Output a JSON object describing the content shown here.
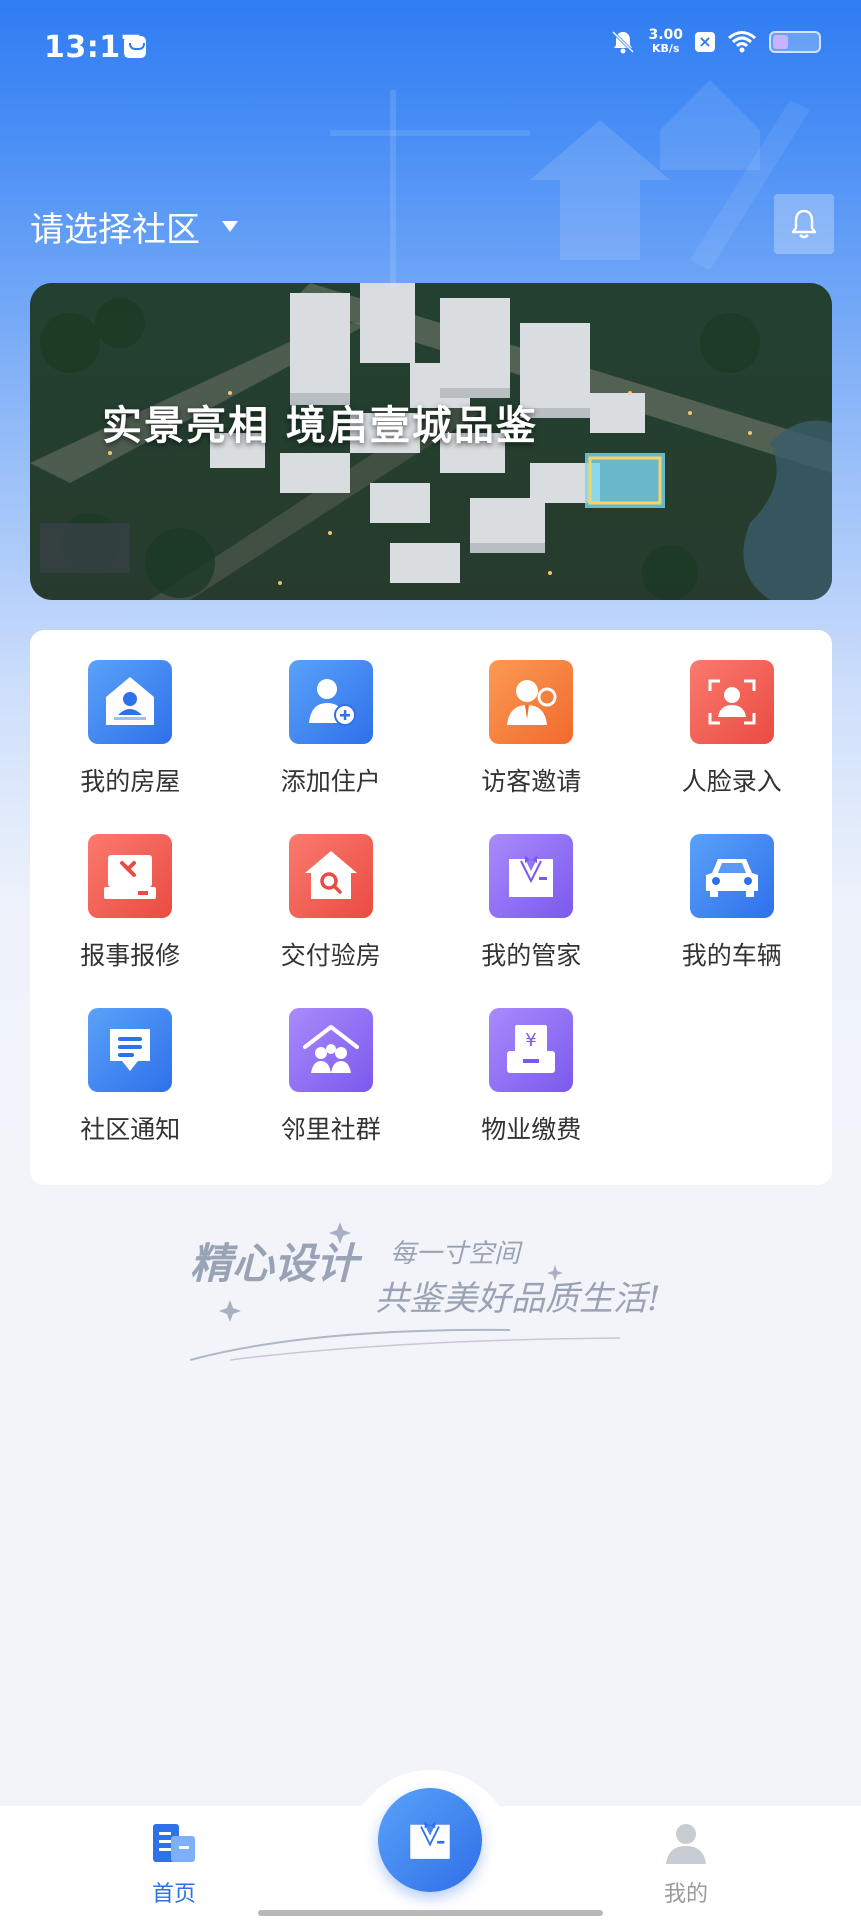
{
  "status_bar": {
    "time": "13:17",
    "net_speed_value": "3.00",
    "net_speed_unit": "KB/s",
    "battery_level": 0.35,
    "icons": [
      "message-icon",
      "bell-off-icon",
      "close-box-icon",
      "wifi-icon",
      "battery-icon"
    ]
  },
  "header": {
    "community_selector": "请选择社区",
    "bell_icon": "bell-icon"
  },
  "banner": {
    "text": "实景亮相 境启壹城品鉴"
  },
  "services": [
    {
      "label": "我的房屋",
      "icon": "house-icon",
      "color": "#2f70eb"
    },
    {
      "label": "添加住户",
      "icon": "add-resident-icon",
      "color": "#2f70eb"
    },
    {
      "label": "访客邀请",
      "icon": "visitor-invite-icon",
      "color": "#f26a2c"
    },
    {
      "label": "人脸录入",
      "icon": "face-scan-icon",
      "color": "#ea4b42"
    },
    {
      "label": "报事报修",
      "icon": "repair-icon",
      "color": "#ea4b42"
    },
    {
      "label": "交付验房",
      "icon": "house-inspect-icon",
      "color": "#ea4b42"
    },
    {
      "label": "我的管家",
      "icon": "butler-icon",
      "color": "#7b59ee"
    },
    {
      "label": "我的车辆",
      "icon": "car-icon",
      "color": "#2f70eb"
    },
    {
      "label": "社区通知",
      "icon": "notice-icon",
      "color": "#2f70eb"
    },
    {
      "label": "邻里社群",
      "icon": "neighbors-icon",
      "color": "#7b59ee"
    },
    {
      "label": "物业缴费",
      "icon": "payment-icon",
      "color": "#7b59ee"
    }
  ],
  "slogan": {
    "line1_big": "精心设计",
    "line1_small": "每一寸空间",
    "line2": "共鉴美好品质生活!"
  },
  "tabbar": {
    "home_label": "首页",
    "mine_label": "我的",
    "center_icon": "butler-icon"
  }
}
